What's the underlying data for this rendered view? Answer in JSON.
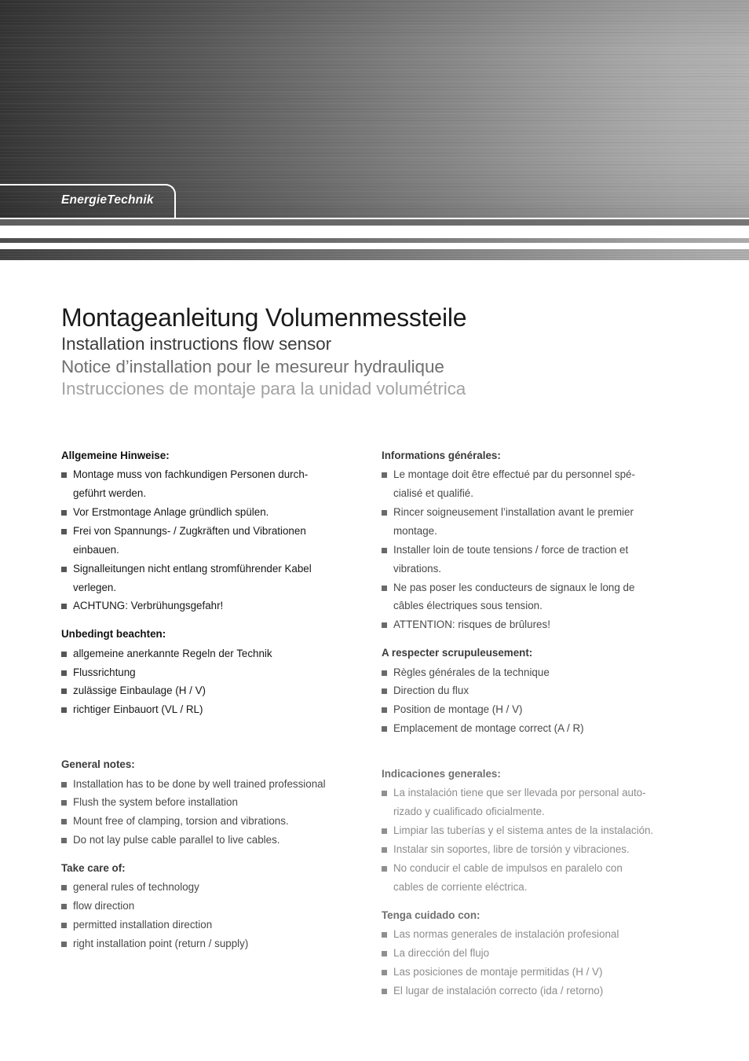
{
  "banner": {
    "logo_text": "EnergieTechnik",
    "gradient_from": "#343434",
    "gradient_to": "#b2b2b2"
  },
  "title": {
    "line_de": "Montageanleitung Volumenmessteile",
    "line_en": "Installation instructions flow sensor",
    "line_fr": "Notice d’installation pour le mesureur hydraulique",
    "line_es": "Instrucciones de montaje para la unidad volumétrica"
  },
  "sections": {
    "de_general": {
      "heading": "Allgemeine Hinweise:",
      "items": [
        "Montage muss von fachkundigen Personen durch-\ngeführt werden.",
        "Vor Erstmontage Anlage gründlich spülen.",
        "Frei von Spannungs- / Zugkräften und Vibrationen\neinbauen.",
        "Signalleitungen nicht entlang stromführender Kabel\nverlegen.",
        "ACHTUNG: Verbrühungsgefahr!"
      ]
    },
    "de_takecare": {
      "heading": "Unbedingt beachten:",
      "items": [
        "allgemeine anerkannte Regeln der Technik",
        "Flussrichtung",
        "zulässige Einbaulage (H / V)",
        "richtiger Einbauort (VL / RL)"
      ]
    },
    "en_general": {
      "heading": "General notes:",
      "items": [
        "Installation has to be done by well trained professional",
        "Flush the system before installation",
        "Mount free of clamping, torsion and vibrations.",
        "Do not lay pulse cable parallel to live cables."
      ]
    },
    "en_takecare": {
      "heading": "Take care of:",
      "items": [
        "general rules of technology",
        "flow direction",
        "permitted installation direction",
        "right installation point (return / supply)"
      ]
    },
    "fr_general": {
      "heading": "Informations générales:",
      "items": [
        "Le montage doit être effectué par du personnel spé-\ncialisé et qualifié.",
        "Rincer soigneusement l’installation avant le premier\nmontage.",
        "Installer loin de toute tensions / force de traction et\nvibrations.",
        "Ne pas poser les conducteurs de signaux le long de\ncâbles électriques sous tension.",
        "ATTENTION: risques de brûlures!"
      ]
    },
    "fr_takecare": {
      "heading": "A respecter scrupuleusement:",
      "items": [
        "Règles générales de la technique",
        "Direction du flux",
        "Position de montage (H / V)",
        "Emplacement de montage correct (A / R)"
      ]
    },
    "es_general": {
      "heading": "Indicaciones generales:",
      "items": [
        "La instalación tiene que ser llevada por personal auto-\nrizado y cualificado oficialmente.",
        "Limpiar las tuberías y el sistema antes de la instalación.",
        "Instalar sin soportes, libre de torsión y vibraciones.",
        "No conducir el cable de impulsos en paralelo con\ncables de corriente eléctrica."
      ]
    },
    "es_takecare": {
      "heading": "Tenga cuidado con:",
      "items": [
        "Las normas generales de instalación profesional",
        "La dirección del flujo",
        "Las posiciones de montaje permitidas (H / V)",
        "El lugar de instalación correcto (ida / retorno)"
      ]
    }
  }
}
